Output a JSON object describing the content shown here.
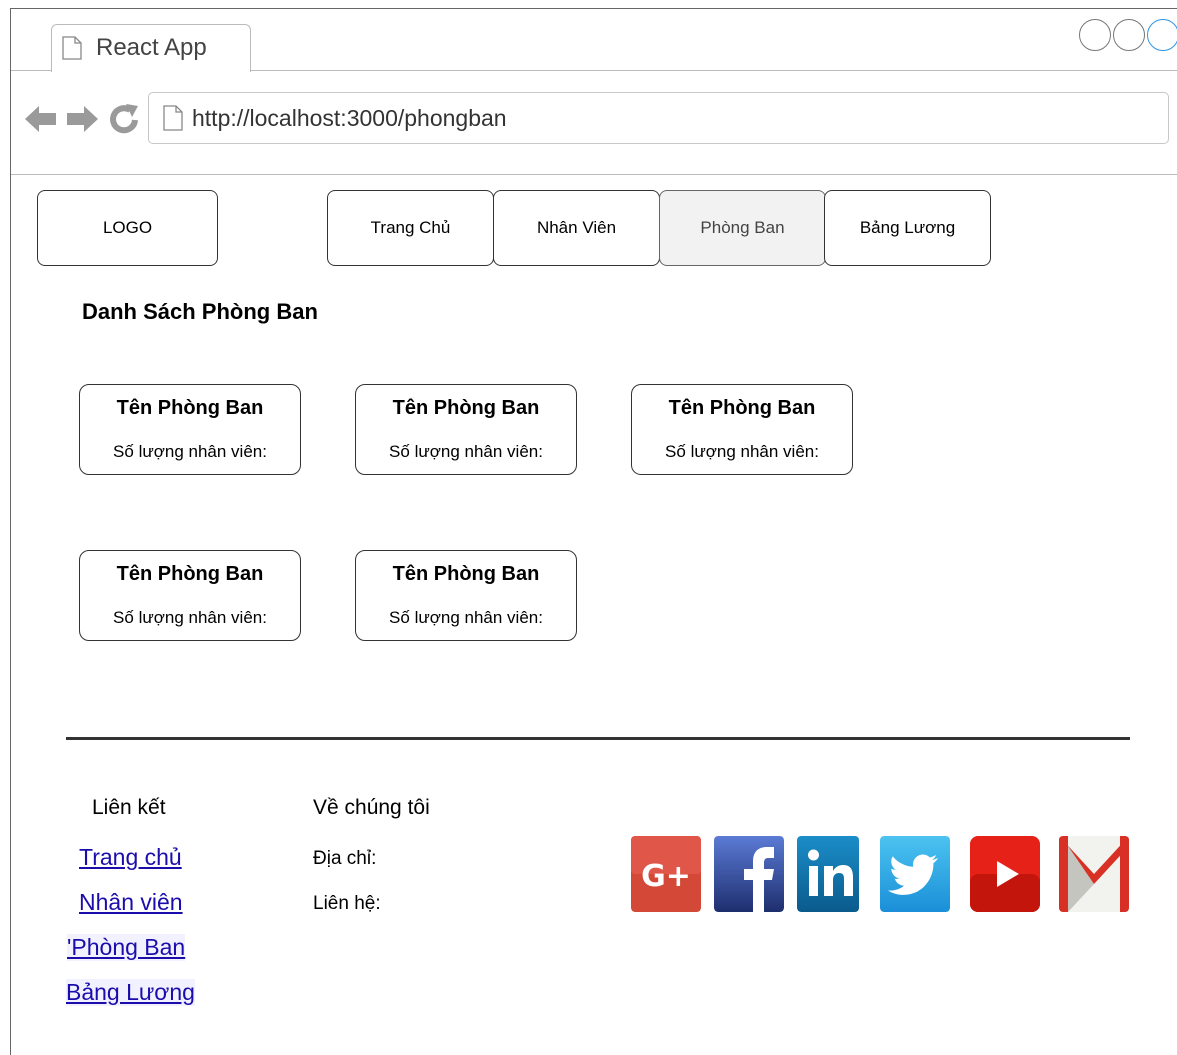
{
  "browser": {
    "tab_title": "React App",
    "url": "http://localhost:3000/phongban"
  },
  "nav": {
    "logo": "LOGO",
    "items": [
      "Trang Chủ",
      "Nhân Viên",
      "Phòng Ban",
      "Bảng Lương"
    ],
    "active": "Phòng Ban"
  },
  "main": {
    "heading": "Danh Sách Phòng Ban",
    "departments": [
      {
        "name": "Tên Phòng Ban",
        "count_label": "Số lượng nhân viên:"
      },
      {
        "name": "Tên Phòng Ban",
        "count_label": "Số lượng nhân viên:"
      },
      {
        "name": "Tên Phòng Ban",
        "count_label": "Số lượng nhân viên:"
      },
      {
        "name": "Tên Phòng Ban",
        "count_label": "Số lượng nhân viên:"
      },
      {
        "name": "Tên Phòng Ban",
        "count_label": "Số lượng nhân viên:"
      }
    ]
  },
  "footer": {
    "links_heading": "Liên kết",
    "links": [
      "Trang chủ",
      "Nhân viên",
      "'Phòng Ban",
      "Bảng Lương"
    ],
    "about_heading": "Về chúng tôi",
    "address_label": "Địa chỉ:",
    "contact_label": "Liên hệ:",
    "social": [
      {
        "icon": "google-plus-icon",
        "color": "#d34836"
      },
      {
        "icon": "facebook-icon",
        "color": "#3b5998"
      },
      {
        "icon": "linkedin-icon",
        "color": "#0e76a8"
      },
      {
        "icon": "twitter-icon",
        "color": "#1da1f2"
      },
      {
        "icon": "youtube-icon",
        "color": "#e62117"
      },
      {
        "icon": "gmail-icon",
        "color": "#d93025"
      }
    ]
  }
}
